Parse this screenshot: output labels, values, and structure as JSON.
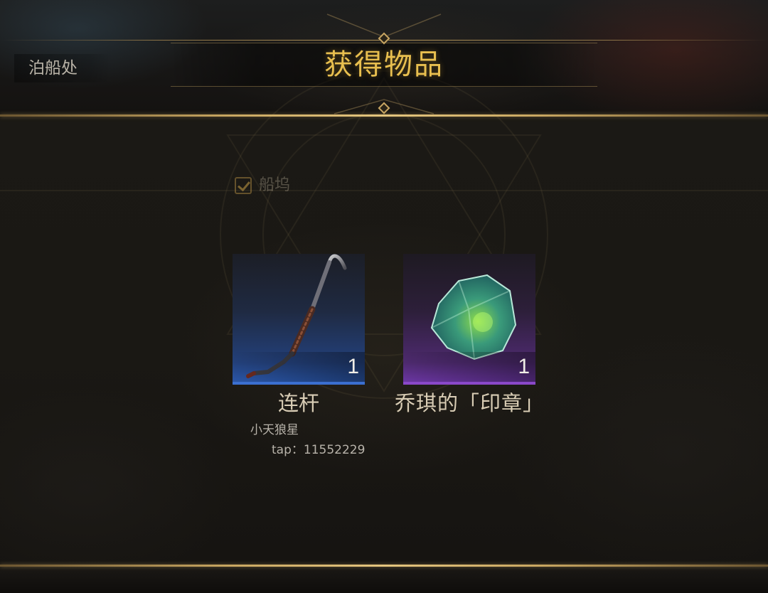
{
  "header": {
    "title": "获得物品",
    "location_label": "泊船处"
  },
  "background_option": {
    "label": "船坞",
    "checked": true
  },
  "items": [
    {
      "name": "连杆",
      "quantity": "1",
      "rarity": "blue",
      "icon": "crowbar-icon"
    },
    {
      "name": "乔琪的「印章」",
      "quantity": "1",
      "rarity": "purple",
      "icon": "green-gem-icon"
    }
  ],
  "watermark": {
    "author": "小天狼星",
    "tap_id": "tap：11552229"
  },
  "colors": {
    "title_gold": "#e8bf4f",
    "border_gold": "#c9a761",
    "rarity_blue": "#3b6fd0",
    "rarity_purple": "#8a48c9"
  }
}
